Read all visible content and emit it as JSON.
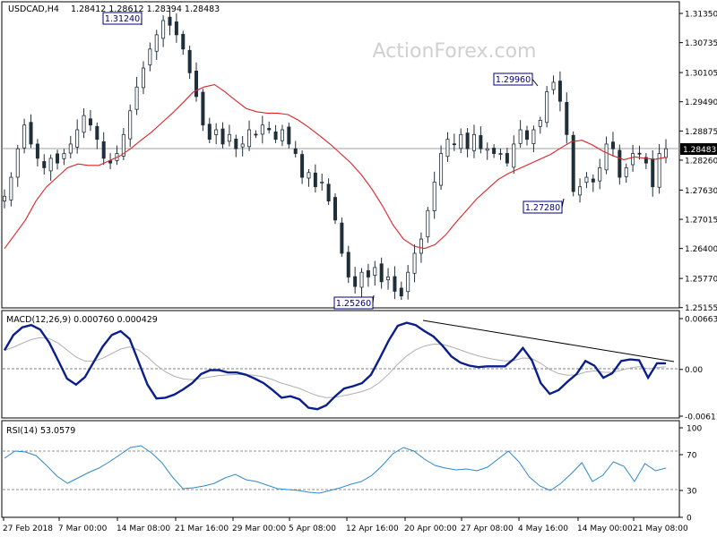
{
  "header": {
    "symbol": "USDCAD,H4",
    "ohlc": "1.28412 1.28612 1.28394 1.28483"
  },
  "watermark": "ActionForex.com",
  "colors": {
    "background": "#ffffff",
    "candles": "#1f2f3a",
    "ma": "#d8262a",
    "macd": "#0a1f8c",
    "signal": "#b0b0b0",
    "rsi": "#2f89c9",
    "axis": "#000000",
    "watermark": "#d9d9d9"
  },
  "chart_data": [
    {
      "type": "candlestick",
      "pane": "price",
      "title": "USDCAD,H4",
      "ylim": [
        1.2515,
        1.3135
      ],
      "y_ticks": [
        "1.31350",
        "1.30735",
        "1.30105",
        "1.29490",
        "1.28875",
        "1.28260",
        "1.27630",
        "1.27015",
        "1.26400",
        "1.25770",
        "1.25155"
      ],
      "current_price": "1.28483",
      "close_series": [
        1.275,
        1.279,
        1.285,
        1.29,
        1.286,
        1.283,
        1.281,
        1.283,
        1.282,
        1.284,
        1.286,
        1.289,
        1.292,
        1.29,
        1.287,
        1.283,
        1.282,
        1.284,
        1.288,
        1.293,
        1.298,
        1.302,
        1.306,
        1.309,
        1.312,
        1.311,
        1.309,
        1.306,
        1.301,
        1.296,
        1.29,
        1.287,
        1.289,
        1.286,
        1.288,
        1.285,
        1.286,
        1.289,
        1.288,
        1.29,
        1.289,
        1.287,
        1.289,
        1.286,
        1.284,
        1.279,
        1.28,
        1.277,
        1.278,
        1.274,
        1.27,
        1.263,
        1.258,
        1.256,
        1.259,
        1.258,
        1.26,
        1.257,
        1.258,
        1.255,
        1.254,
        1.259,
        1.263,
        1.266,
        1.272,
        1.278,
        1.284,
        1.287,
        1.286,
        1.288,
        1.285,
        1.288,
        1.285,
        1.285,
        1.284,
        1.284,
        1.282,
        1.286,
        1.289,
        1.287,
        1.289,
        1.291,
        1.297,
        1.299,
        1.295,
        1.288,
        1.276,
        1.277,
        1.279,
        1.278,
        1.281,
        1.286,
        1.285,
        1.279,
        1.281,
        1.284,
        1.284,
        1.282,
        1.277,
        1.284,
        1.285
      ],
      "ma_series": [
        1.264,
        1.267,
        1.27,
        1.274,
        1.277,
        1.279,
        1.281,
        1.2818,
        1.2815,
        1.2815,
        1.2825,
        1.2835,
        1.285,
        1.2868,
        1.2885,
        1.2905,
        1.2925,
        1.2947,
        1.297,
        1.298,
        1.2985,
        1.297,
        1.2952,
        1.2935,
        1.2928,
        1.2925,
        1.2925,
        1.2922,
        1.291,
        1.2895,
        1.2878,
        1.286,
        1.284,
        1.282,
        1.2795,
        1.2765,
        1.273,
        1.269,
        1.266,
        1.2645,
        1.264,
        1.2648,
        1.2668,
        1.2695,
        1.272,
        1.2745,
        1.2765,
        1.2785,
        1.2798,
        1.2808,
        1.2818,
        1.2828,
        1.2838,
        1.2852,
        1.2865,
        1.2868,
        1.2858,
        1.2845,
        1.2835,
        1.2827,
        1.2833,
        1.283,
        1.2828,
        1.2832
      ],
      "annotations": [
        "1.31240",
        "1.29960",
        "1.27280",
        "1.25260"
      ]
    },
    {
      "type": "line",
      "pane": "macd",
      "title": "MACD(12,26,9) 0.000760 0.000429",
      "ylim": [
        -0.006114,
        0.006639
      ],
      "y_ticks": [
        "0.006639",
        "0.00",
        "-0.006114"
      ],
      "series": [
        {
          "values": [
            0.0025,
            0.0045,
            0.0055,
            0.0058,
            0.0052,
            0.0035,
            0.0012,
            -0.0012,
            -0.002,
            -0.001,
            0.001,
            0.003,
            0.0045,
            0.005,
            0.004,
            0.001,
            -0.002,
            -0.0038,
            -0.0037,
            -0.0033,
            -0.0026,
            -0.0018,
            -0.0006,
            -0.0001,
            -0.0001,
            -0.0004,
            -0.0004,
            -0.0007,
            -0.0012,
            -0.0018,
            -0.0027,
            -0.0037,
            -0.0035,
            -0.0039,
            -0.005,
            -0.0052,
            -0.0047,
            -0.0035,
            -0.0025,
            -0.0022,
            -0.0018,
            -0.0007,
            0.0015,
            0.0038,
            0.0057,
            0.0061,
            0.0058,
            0.005,
            0.0043,
            0.0031,
            0.0017,
            0.0009,
            0.0005,
            0.0003,
            0.0004,
            0.0004,
            0.0004,
            0.0014,
            0.0028,
            0.0012,
            -0.0018,
            -0.0032,
            -0.0027,
            -0.0016,
            -0.0006,
            0.0011,
            0.0005,
            -0.0011,
            -0.0005,
            0.0011,
            0.0013,
            0.0012,
            -0.0011,
            0.0008,
            0.0008
          ]
        }
      ],
      "trendline": true
    },
    {
      "type": "line",
      "pane": "rsi",
      "title": "RSI(14) 53.0579",
      "ylim": [
        0,
        100
      ],
      "y_ticks": [
        "100",
        "70",
        "30",
        "0"
      ],
      "series": [
        {
          "values": [
            66,
            74,
            73,
            69,
            58,
            46,
            38,
            44,
            50,
            55,
            62,
            70,
            78,
            80,
            72,
            61,
            45,
            32,
            33,
            35,
            38,
            44,
            48,
            42,
            40,
            36,
            32,
            31,
            30,
            28,
            27,
            30,
            33,
            37,
            40,
            47,
            58,
            71,
            78,
            74,
            65,
            58,
            55,
            53,
            54,
            52,
            56,
            65,
            74,
            62,
            45,
            35,
            30,
            38,
            49,
            61,
            40,
            47,
            62,
            57,
            40,
            60,
            52,
            55
          ]
        }
      ]
    }
  ],
  "x_axis": {
    "ticks": [
      "27 Feb 2018",
      "7 Mar 00:00",
      "14 Mar 08:00",
      "21 Mar 16:00",
      "29 Mar 00:00",
      "5 Apr 08:00",
      "12 Apr 16:00",
      "20 Apr 00:00",
      "27 Apr 08:00",
      "4 May 16:00",
      "14 May 00:00",
      "21 May 08:00"
    ]
  }
}
